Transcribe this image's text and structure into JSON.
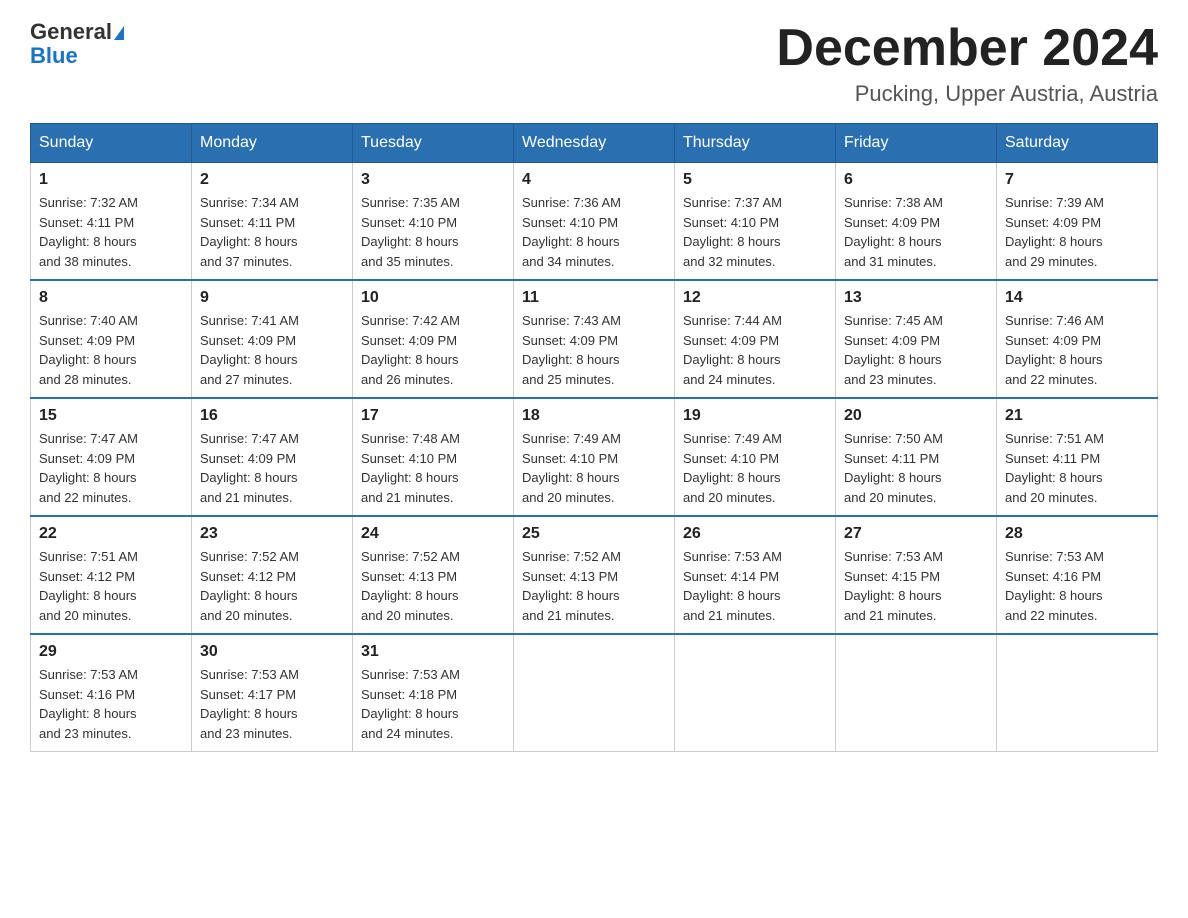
{
  "logo": {
    "text_general": "General",
    "text_blue": "Blue"
  },
  "title": "December 2024",
  "subtitle": "Pucking, Upper Austria, Austria",
  "days_of_week": [
    "Sunday",
    "Monday",
    "Tuesday",
    "Wednesday",
    "Thursday",
    "Friday",
    "Saturday"
  ],
  "weeks": [
    [
      {
        "day": "1",
        "sunrise": "7:32 AM",
        "sunset": "4:11 PM",
        "daylight": "8 hours and 38 minutes."
      },
      {
        "day": "2",
        "sunrise": "7:34 AM",
        "sunset": "4:11 PM",
        "daylight": "8 hours and 37 minutes."
      },
      {
        "day": "3",
        "sunrise": "7:35 AM",
        "sunset": "4:10 PM",
        "daylight": "8 hours and 35 minutes."
      },
      {
        "day": "4",
        "sunrise": "7:36 AM",
        "sunset": "4:10 PM",
        "daylight": "8 hours and 34 minutes."
      },
      {
        "day": "5",
        "sunrise": "7:37 AM",
        "sunset": "4:10 PM",
        "daylight": "8 hours and 32 minutes."
      },
      {
        "day": "6",
        "sunrise": "7:38 AM",
        "sunset": "4:09 PM",
        "daylight": "8 hours and 31 minutes."
      },
      {
        "day": "7",
        "sunrise": "7:39 AM",
        "sunset": "4:09 PM",
        "daylight": "8 hours and 29 minutes."
      }
    ],
    [
      {
        "day": "8",
        "sunrise": "7:40 AM",
        "sunset": "4:09 PM",
        "daylight": "8 hours and 28 minutes."
      },
      {
        "day": "9",
        "sunrise": "7:41 AM",
        "sunset": "4:09 PM",
        "daylight": "8 hours and 27 minutes."
      },
      {
        "day": "10",
        "sunrise": "7:42 AM",
        "sunset": "4:09 PM",
        "daylight": "8 hours and 26 minutes."
      },
      {
        "day": "11",
        "sunrise": "7:43 AM",
        "sunset": "4:09 PM",
        "daylight": "8 hours and 25 minutes."
      },
      {
        "day": "12",
        "sunrise": "7:44 AM",
        "sunset": "4:09 PM",
        "daylight": "8 hours and 24 minutes."
      },
      {
        "day": "13",
        "sunrise": "7:45 AM",
        "sunset": "4:09 PM",
        "daylight": "8 hours and 23 minutes."
      },
      {
        "day": "14",
        "sunrise": "7:46 AM",
        "sunset": "4:09 PM",
        "daylight": "8 hours and 22 minutes."
      }
    ],
    [
      {
        "day": "15",
        "sunrise": "7:47 AM",
        "sunset": "4:09 PM",
        "daylight": "8 hours and 22 minutes."
      },
      {
        "day": "16",
        "sunrise": "7:47 AM",
        "sunset": "4:09 PM",
        "daylight": "8 hours and 21 minutes."
      },
      {
        "day": "17",
        "sunrise": "7:48 AM",
        "sunset": "4:10 PM",
        "daylight": "8 hours and 21 minutes."
      },
      {
        "day": "18",
        "sunrise": "7:49 AM",
        "sunset": "4:10 PM",
        "daylight": "8 hours and 20 minutes."
      },
      {
        "day": "19",
        "sunrise": "7:49 AM",
        "sunset": "4:10 PM",
        "daylight": "8 hours and 20 minutes."
      },
      {
        "day": "20",
        "sunrise": "7:50 AM",
        "sunset": "4:11 PM",
        "daylight": "8 hours and 20 minutes."
      },
      {
        "day": "21",
        "sunrise": "7:51 AM",
        "sunset": "4:11 PM",
        "daylight": "8 hours and 20 minutes."
      }
    ],
    [
      {
        "day": "22",
        "sunrise": "7:51 AM",
        "sunset": "4:12 PM",
        "daylight": "8 hours and 20 minutes."
      },
      {
        "day": "23",
        "sunrise": "7:52 AM",
        "sunset": "4:12 PM",
        "daylight": "8 hours and 20 minutes."
      },
      {
        "day": "24",
        "sunrise": "7:52 AM",
        "sunset": "4:13 PM",
        "daylight": "8 hours and 20 minutes."
      },
      {
        "day": "25",
        "sunrise": "7:52 AM",
        "sunset": "4:13 PM",
        "daylight": "8 hours and 21 minutes."
      },
      {
        "day": "26",
        "sunrise": "7:53 AM",
        "sunset": "4:14 PM",
        "daylight": "8 hours and 21 minutes."
      },
      {
        "day": "27",
        "sunrise": "7:53 AM",
        "sunset": "4:15 PM",
        "daylight": "8 hours and 21 minutes."
      },
      {
        "day": "28",
        "sunrise": "7:53 AM",
        "sunset": "4:16 PM",
        "daylight": "8 hours and 22 minutes."
      }
    ],
    [
      {
        "day": "29",
        "sunrise": "7:53 AM",
        "sunset": "4:16 PM",
        "daylight": "8 hours and 23 minutes."
      },
      {
        "day": "30",
        "sunrise": "7:53 AM",
        "sunset": "4:17 PM",
        "daylight": "8 hours and 23 minutes."
      },
      {
        "day": "31",
        "sunrise": "7:53 AM",
        "sunset": "4:18 PM",
        "daylight": "8 hours and 24 minutes."
      },
      null,
      null,
      null,
      null
    ]
  ],
  "labels": {
    "sunrise": "Sunrise:",
    "sunset": "Sunset:",
    "daylight": "Daylight:"
  }
}
